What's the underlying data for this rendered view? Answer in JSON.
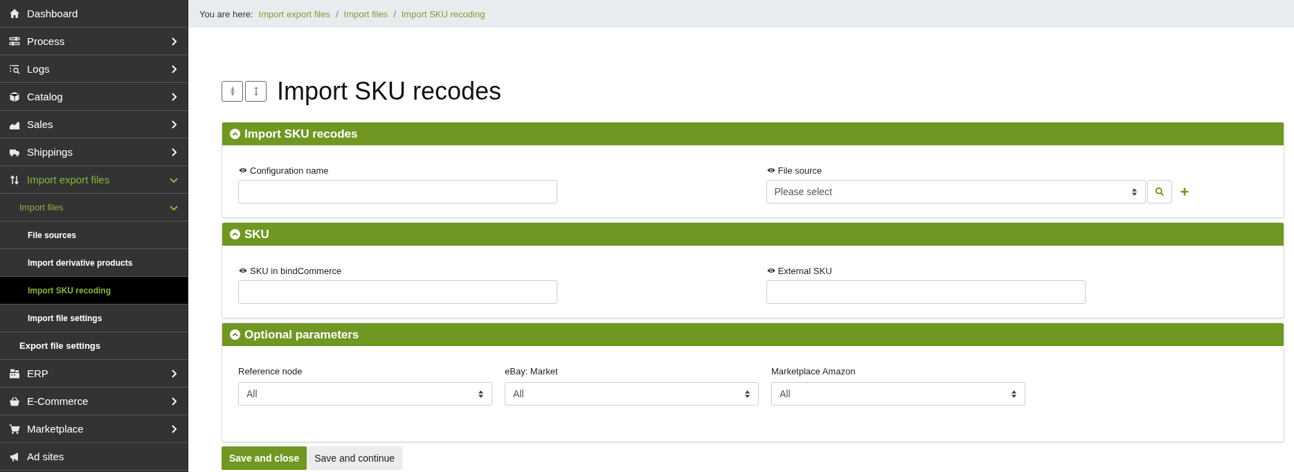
{
  "sidebar": {
    "items": [
      {
        "label": "Dashboard",
        "selected": false
      },
      {
        "label": "Process",
        "selected": false,
        "expanded": false
      },
      {
        "label": "Logs",
        "selected": false,
        "expanded": false
      },
      {
        "label": "Catalog",
        "selected": false,
        "expanded": false
      },
      {
        "label": "Sales",
        "selected": false,
        "expanded": false
      },
      {
        "label": "Shippings",
        "selected": false,
        "expanded": false
      },
      {
        "label": "Import export files",
        "selected": false,
        "expanded": true,
        "children": [
          {
            "label": "Import files",
            "selected": false,
            "expanded": true,
            "children": [
              {
                "label": "File sources",
                "selected": false
              },
              {
                "label": "Import derivative products",
                "selected": false
              },
              {
                "label": "Import SKU recoding",
                "selected": true
              },
              {
                "label": "Import file settings",
                "selected": false
              }
            ]
          },
          {
            "label": "Export file settings",
            "selected": false
          }
        ]
      },
      {
        "label": "ERP",
        "selected": false,
        "expanded": false
      },
      {
        "label": "E-Commerce",
        "selected": false,
        "expanded": false
      },
      {
        "label": "Marketplace",
        "selected": false,
        "expanded": false
      },
      {
        "label": "Ad sites",
        "selected": false
      }
    ]
  },
  "breadcrumb": {
    "prefix": "You are here:",
    "links": [
      "Import export files",
      "Import files",
      "Import SKU recoding"
    ],
    "separators": [
      "/",
      "/"
    ]
  },
  "page_title": "Import SKU recodes",
  "panels": [
    {
      "title": "Import SKU recodes",
      "expanded": true,
      "fields": [
        {
          "kind": "input",
          "label": "Configuration name",
          "visibility_icon": true
        },
        {
          "kind": "lookup",
          "label": "File source",
          "visibility_icon": true,
          "value": "Please select"
        }
      ]
    },
    {
      "title": "SKU",
      "expanded": true,
      "fields": [
        {
          "kind": "input",
          "label": "SKU in bindCommerce",
          "visibility_icon": true
        },
        {
          "kind": "input",
          "label": "External SKU",
          "visibility_icon": true
        }
      ]
    },
    {
      "title": "Optional parameters",
      "expanded": true,
      "fields": [
        {
          "kind": "select",
          "label": "Reference node",
          "visibility_icon": false,
          "value": "All"
        },
        {
          "kind": "select",
          "label": "eBay: Market",
          "visibility_icon": false,
          "value": "All"
        },
        {
          "kind": "select",
          "label": "Marketplace Amazon",
          "visibility_icon": false,
          "value": "All"
        }
      ]
    }
  ],
  "buttons": [
    {
      "label": "Save and close",
      "kind": "primary"
    },
    {
      "label": "Save and continue",
      "kind": "secondary"
    }
  ]
}
